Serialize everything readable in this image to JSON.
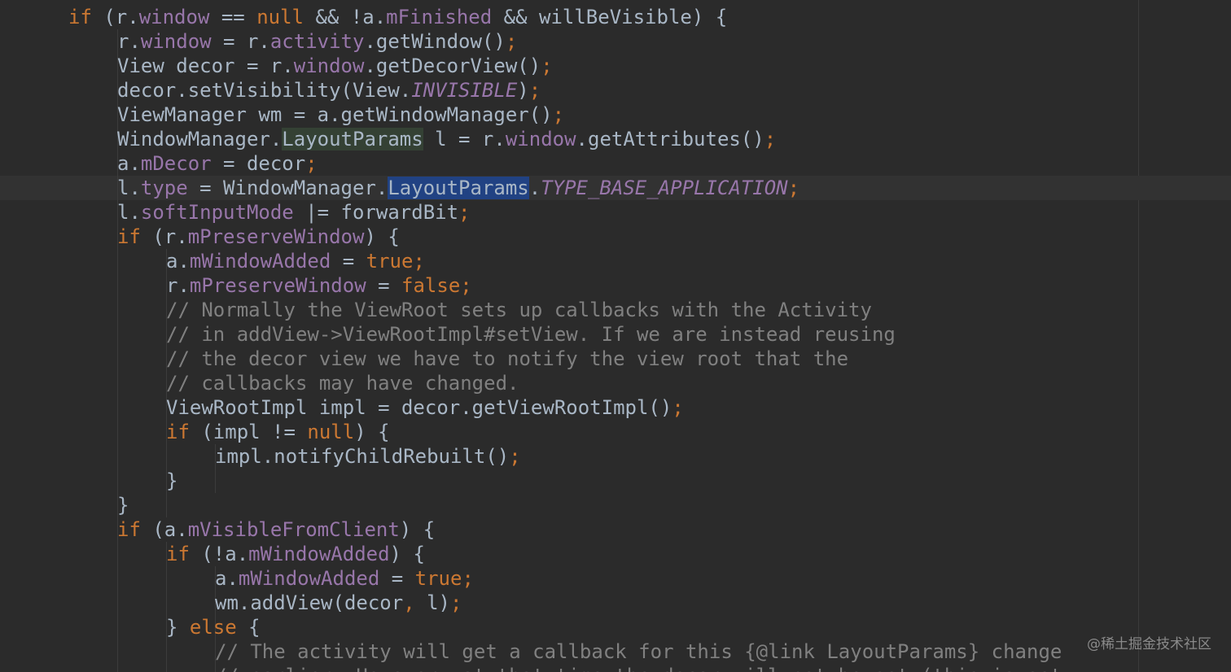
{
  "editor": {
    "theme": {
      "background": "#2b2b2b",
      "default": "#a9b7c6",
      "keyword": "#cc7832",
      "field": "#9876aa",
      "comment": "#808080",
      "usage_highlight": "#344134",
      "selection": "#214283"
    },
    "lines": [
      {
        "indent": 1,
        "tokens": [
          {
            "t": "if",
            "c": "kw"
          },
          {
            "t": " (r."
          },
          {
            "t": "window",
            "c": "fld"
          },
          {
            "t": " == "
          },
          {
            "t": "null",
            "c": "kw"
          },
          {
            "t": " && !a."
          },
          {
            "t": "mFinished",
            "c": "fld"
          },
          {
            "t": " && willBeVisible) {"
          }
        ]
      },
      {
        "indent": 2,
        "tokens": [
          {
            "t": "r."
          },
          {
            "t": "window",
            "c": "fld"
          },
          {
            "t": " = r."
          },
          {
            "t": "activity",
            "c": "fld"
          },
          {
            "t": ".getWindow()"
          },
          {
            "t": ";",
            "c": "kw"
          }
        ]
      },
      {
        "indent": 2,
        "tokens": [
          {
            "t": "View decor = r."
          },
          {
            "t": "window",
            "c": "fld"
          },
          {
            "t": ".getDecorView()"
          },
          {
            "t": ";",
            "c": "kw"
          }
        ]
      },
      {
        "indent": 2,
        "tokens": [
          {
            "t": "decor.setVisibility(View."
          },
          {
            "t": "INVISIBLE",
            "c": "cst"
          },
          {
            "t": ")"
          },
          {
            "t": ";",
            "c": "kw"
          }
        ]
      },
      {
        "indent": 2,
        "tokens": [
          {
            "t": "ViewManager wm = a.getWindowManager()"
          },
          {
            "t": ";",
            "c": "kw"
          }
        ]
      },
      {
        "indent": 2,
        "tokens": [
          {
            "t": "WindowManager."
          },
          {
            "t": "LayoutParams",
            "c": "usage-hl"
          },
          {
            "t": " l = r."
          },
          {
            "t": "window",
            "c": "fld"
          },
          {
            "t": ".getAttributes()"
          },
          {
            "t": ";",
            "c": "kw"
          }
        ]
      },
      {
        "indent": 2,
        "tokens": [
          {
            "t": "a."
          },
          {
            "t": "mDecor",
            "c": "fld"
          },
          {
            "t": " = decor"
          },
          {
            "t": ";",
            "c": "kw"
          }
        ]
      },
      {
        "indent": 2,
        "current": true,
        "tokens": [
          {
            "t": "l."
          },
          {
            "t": "type",
            "c": "fld"
          },
          {
            "t": " = WindowManager."
          },
          {
            "t": "LayoutParams",
            "c": "sel-hl"
          },
          {
            "t": "."
          },
          {
            "t": "TYPE_BASE_APPLICATION",
            "c": "cst"
          },
          {
            "t": ";",
            "c": "kw"
          }
        ]
      },
      {
        "indent": 2,
        "tokens": [
          {
            "t": "l."
          },
          {
            "t": "softInputMode",
            "c": "fld"
          },
          {
            "t": " |= forwardBit"
          },
          {
            "t": ";",
            "c": "kw"
          }
        ]
      },
      {
        "indent": 2,
        "tokens": [
          {
            "t": "if",
            "c": "kw"
          },
          {
            "t": " (r."
          },
          {
            "t": "mPreserveWindow",
            "c": "fld"
          },
          {
            "t": ") {"
          }
        ]
      },
      {
        "indent": 3,
        "tokens": [
          {
            "t": "a."
          },
          {
            "t": "mWindowAdded",
            "c": "fld"
          },
          {
            "t": " = "
          },
          {
            "t": "true;",
            "c": "kw"
          }
        ]
      },
      {
        "indent": 3,
        "tokens": [
          {
            "t": "r."
          },
          {
            "t": "mPreserveWindow",
            "c": "fld"
          },
          {
            "t": " = "
          },
          {
            "t": "false;",
            "c": "kw"
          }
        ]
      },
      {
        "indent": 3,
        "tokens": [
          {
            "t": "// Normally the ViewRoot sets up callbacks with the Activity",
            "c": "cmt"
          }
        ]
      },
      {
        "indent": 3,
        "tokens": [
          {
            "t": "// in addView->ViewRootImpl#setView. If we are instead reusing",
            "c": "cmt"
          }
        ]
      },
      {
        "indent": 3,
        "tokens": [
          {
            "t": "// the decor view we have to notify the view root that the",
            "c": "cmt"
          }
        ]
      },
      {
        "indent": 3,
        "tokens": [
          {
            "t": "// callbacks may have changed.",
            "c": "cmt"
          }
        ]
      },
      {
        "indent": 3,
        "tokens": [
          {
            "t": "ViewRootImpl impl = decor.getViewRootImpl()"
          },
          {
            "t": ";",
            "c": "kw"
          }
        ]
      },
      {
        "indent": 3,
        "tokens": [
          {
            "t": "if",
            "c": "kw"
          },
          {
            "t": " (impl != "
          },
          {
            "t": "null",
            "c": "kw"
          },
          {
            "t": ") {"
          }
        ]
      },
      {
        "indent": 4,
        "tokens": [
          {
            "t": "impl.notifyChildRebuilt()"
          },
          {
            "t": ";",
            "c": "kw"
          }
        ]
      },
      {
        "indent": 3,
        "tokens": [
          {
            "t": "}"
          }
        ]
      },
      {
        "indent": 2,
        "tokens": [
          {
            "t": "}"
          }
        ]
      },
      {
        "indent": 2,
        "tokens": [
          {
            "t": "if",
            "c": "kw"
          },
          {
            "t": " (a."
          },
          {
            "t": "mVisibleFromClient",
            "c": "fld"
          },
          {
            "t": ") {"
          }
        ]
      },
      {
        "indent": 3,
        "tokens": [
          {
            "t": "if",
            "c": "kw"
          },
          {
            "t": " (!a."
          },
          {
            "t": "mWindowAdded",
            "c": "fld"
          },
          {
            "t": ") {"
          }
        ]
      },
      {
        "indent": 4,
        "tokens": [
          {
            "t": "a."
          },
          {
            "t": "mWindowAdded",
            "c": "fld"
          },
          {
            "t": " = "
          },
          {
            "t": "true;",
            "c": "kw"
          }
        ]
      },
      {
        "indent": 4,
        "tokens": [
          {
            "t": "wm.addView(decor"
          },
          {
            "t": ",",
            "c": "kw"
          },
          {
            "t": " l)"
          },
          {
            "t": ";",
            "c": "kw"
          }
        ]
      },
      {
        "indent": 3,
        "tokens": [
          {
            "t": "} "
          },
          {
            "t": "else",
            "c": "kw"
          },
          {
            "t": " {"
          }
        ]
      },
      {
        "indent": 4,
        "tokens": [
          {
            "t": "// The activity will get a callback for this {@link LayoutParams} change",
            "c": "cmt"
          }
        ]
      },
      {
        "indent": 4,
        "tokens": [
          {
            "t": "// earlier. However, at that time the decor will not be set (this is set",
            "c": "cmt"
          }
        ]
      }
    ]
  },
  "watermark": "@稀土掘金技术社区"
}
